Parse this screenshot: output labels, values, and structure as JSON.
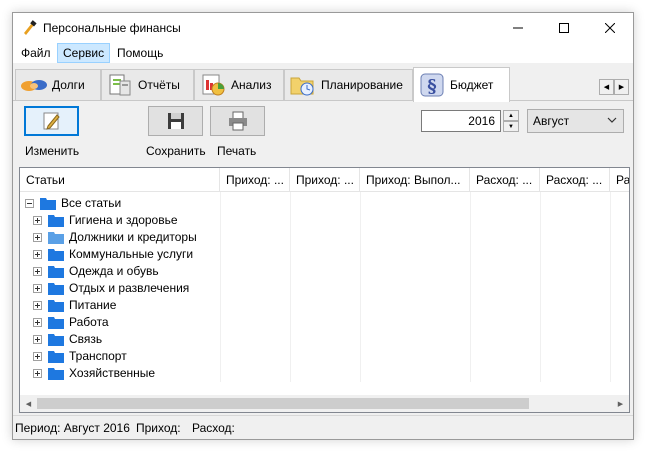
{
  "window": {
    "title": "Персональные финансы",
    "controls": {
      "minimize": "minimize-icon",
      "maximize": "maximize-icon",
      "close": "close-icon"
    }
  },
  "menu": {
    "items": [
      "Файл",
      "Сервис",
      "Помощь"
    ],
    "active_index": 1
  },
  "tabs": {
    "items": [
      {
        "label": "Долги",
        "icon": "handshake-icon"
      },
      {
        "label": "Отчёты",
        "icon": "report-icon"
      },
      {
        "label": "Анализ",
        "icon": "chart-icon"
      },
      {
        "label": "Планирование",
        "icon": "planning-folder-icon"
      },
      {
        "label": "Бюджет",
        "icon": "budget-icon"
      }
    ],
    "selected_index": 4
  },
  "toolbar": {
    "edit_label": "Изменить",
    "save_label": "Сохранить",
    "print_label": "Печать"
  },
  "period": {
    "year": "2016",
    "month": "Август"
  },
  "grid": {
    "columns": [
      "Статьи",
      "Приход: ...",
      "Приход: ...",
      "Приход: Выпол...",
      "Расход: ...",
      "Расход: ...",
      "Ра"
    ],
    "root": {
      "label": "Все статьи",
      "expanded": true
    },
    "rows": [
      {
        "label": "Гигиена и здоровье"
      },
      {
        "label": "Должники и кредиторы"
      },
      {
        "label": "Коммунальные услуги"
      },
      {
        "label": "Одежда и обувь"
      },
      {
        "label": "Отдых и развлечения"
      },
      {
        "label": "Питание"
      },
      {
        "label": "Работа"
      },
      {
        "label": "Связь"
      },
      {
        "label": "Транспорт"
      },
      {
        "label": "Хозяйственные"
      }
    ]
  },
  "status": {
    "period": "Период: Август 2016",
    "income": "Приход:",
    "expense": "Расход:"
  },
  "colors": {
    "accent": "#0078d7",
    "folder": "#1e78e0",
    "menu_highlight": "#cce8ff"
  }
}
